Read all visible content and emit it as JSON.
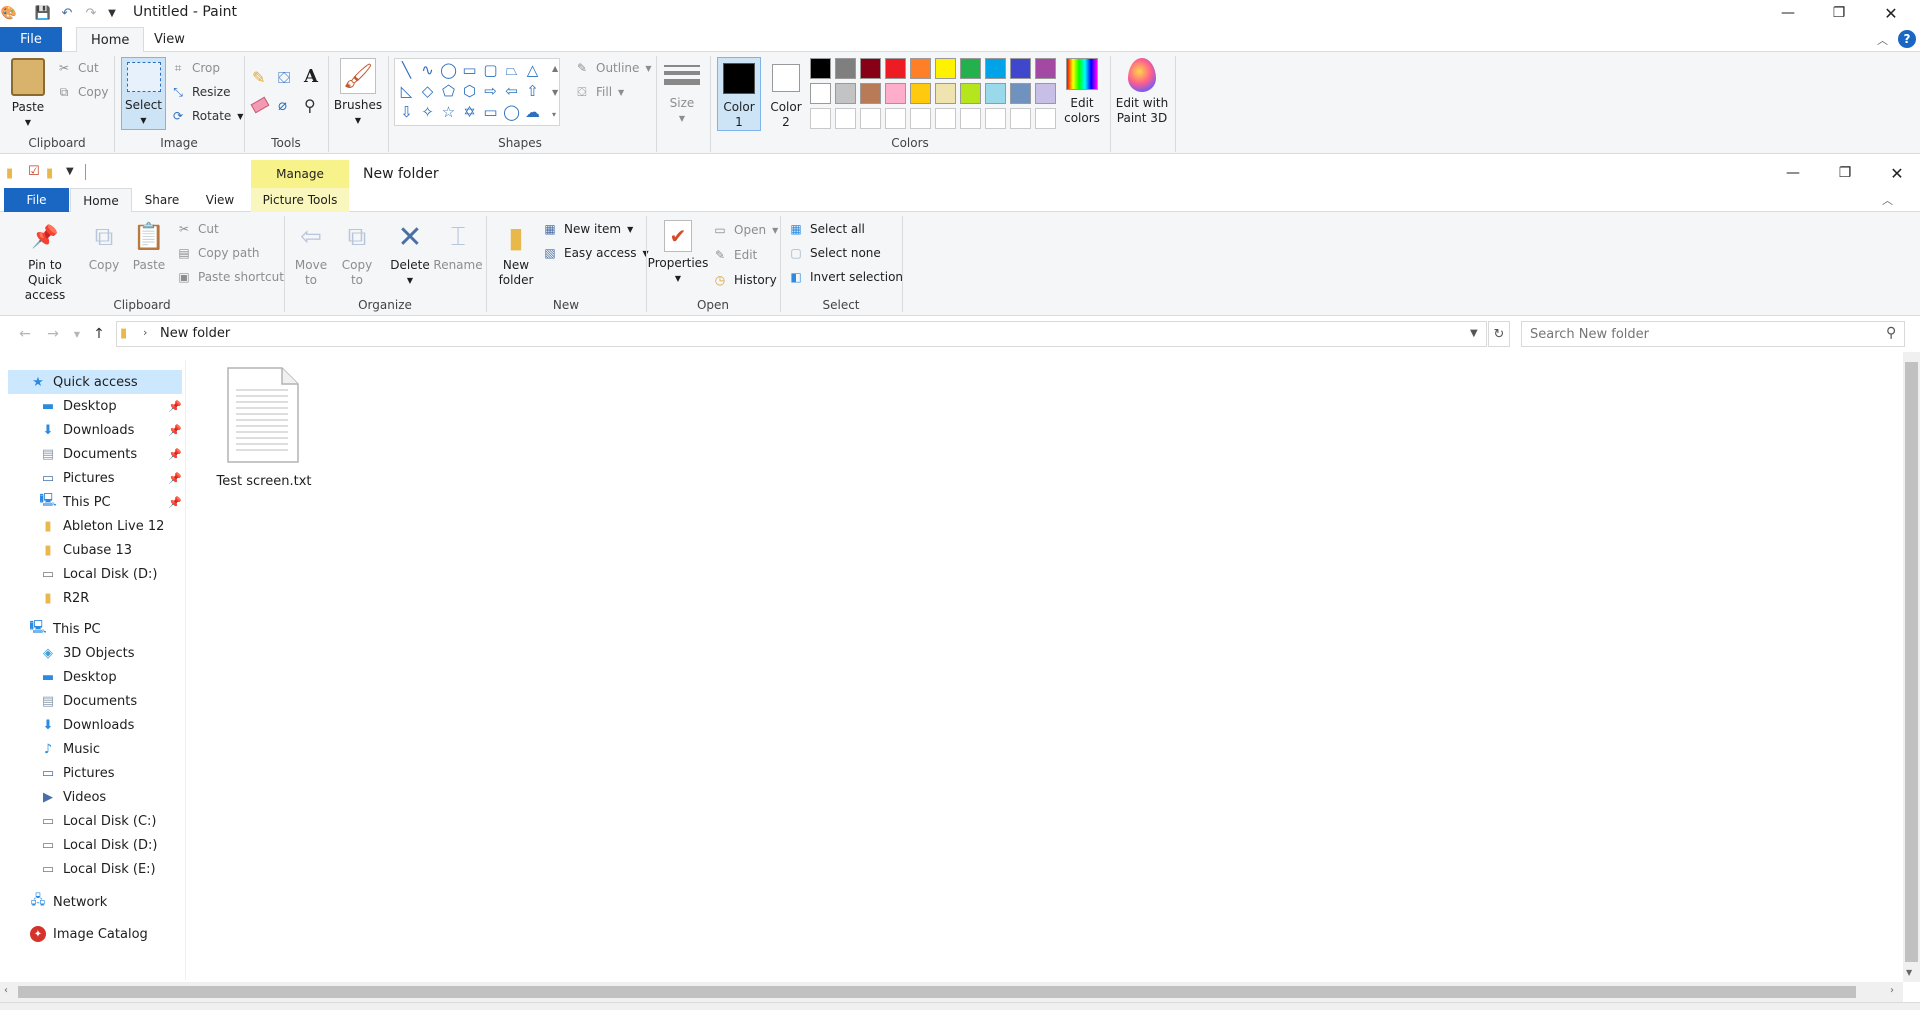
{
  "paint": {
    "title": "Untitled - Paint",
    "tabs": [
      "File",
      "Home",
      "View"
    ],
    "clipboard": {
      "paste": "Paste",
      "cut": "Cut",
      "copy": "Copy",
      "label": "Clipboard"
    },
    "image": {
      "select": "Select",
      "crop": "Crop",
      "resize": "Resize",
      "rotate": "Rotate",
      "label": "Image"
    },
    "tools": {
      "label": "Tools"
    },
    "brushes": "Brushes",
    "shapes": {
      "outline": "Outline",
      "fill": "Fill",
      "label": "Shapes"
    },
    "size": "Size",
    "color1": {
      "line1": "Color",
      "line2": "1"
    },
    "color2": {
      "line1": "Color",
      "line2": "2"
    },
    "colors": {
      "label": "Colors",
      "edit_colors_1": "Edit",
      "edit_colors_2": "colors",
      "row1": [
        "#000000",
        "#7f7f7f",
        "#880015",
        "#ed1c24",
        "#ff7f27",
        "#fff200",
        "#22b14c",
        "#00a2e8",
        "#3f48cc",
        "#a349a4"
      ],
      "row2": [
        "#ffffff",
        "#c3c3c3",
        "#b97a57",
        "#ffaec9",
        "#ffc90e",
        "#efe4b0",
        "#b5e61d",
        "#99d9ea",
        "#7092be",
        "#c8bfe7"
      ]
    },
    "edit_3d_1": "Edit with",
    "edit_3d_2": "Paint 3D"
  },
  "explorer": {
    "title": "New folder",
    "manage": "Manage",
    "picture_tools": "Picture Tools",
    "tabs": [
      "File",
      "Home",
      "Share",
      "View"
    ],
    "clipboard": {
      "pin_1": "Pin to Quick",
      "pin_2": "access",
      "copy": "Copy",
      "paste": "Paste",
      "cut": "Cut",
      "copy_path": "Copy path",
      "paste_shortcut": "Paste shortcut",
      "label": "Clipboard"
    },
    "organize": {
      "move_1": "Move",
      "move_2": "to",
      "copy_1": "Copy",
      "copy_2": "to",
      "delete": "Delete",
      "rename": "Rename",
      "label": "Organize"
    },
    "new": {
      "new_folder_1": "New",
      "new_folder_2": "folder",
      "new_item": "New item",
      "easy_access": "Easy access",
      "label": "New"
    },
    "open": {
      "properties": "Properties",
      "open": "Open",
      "edit": "Edit",
      "history": "History",
      "label": "Open"
    },
    "select": {
      "select_all": "Select all",
      "select_none": "Select none",
      "invert": "Invert selection",
      "label": "Select"
    },
    "address": {
      "path": "New folder",
      "search_placeholder": "Search New folder"
    },
    "nav": {
      "quick_access": "Quick access",
      "quick_items": [
        {
          "label": "Desktop",
          "pinned": true
        },
        {
          "label": "Downloads",
          "pinned": true
        },
        {
          "label": "Documents",
          "pinned": true
        },
        {
          "label": "Pictures",
          "pinned": true
        },
        {
          "label": "This PC",
          "pinned": true
        },
        {
          "label": "Ableton Live 12",
          "pinned": false
        },
        {
          "label": "Cubase 13",
          "pinned": false
        },
        {
          "label": "Local Disk (D:)",
          "pinned": false
        },
        {
          "label": "R2R",
          "pinned": false
        }
      ],
      "this_pc": "This PC",
      "pc_items": [
        "3D Objects",
        "Desktop",
        "Documents",
        "Downloads",
        "Music",
        "Pictures",
        "Videos",
        "Local Disk (C:)",
        "Local Disk (D:)",
        "Local Disk (E:)"
      ],
      "network": "Network",
      "image_catalog": "Image Catalog"
    },
    "files": [
      {
        "name": "Test screen.txt",
        "type": "txt"
      }
    ]
  }
}
